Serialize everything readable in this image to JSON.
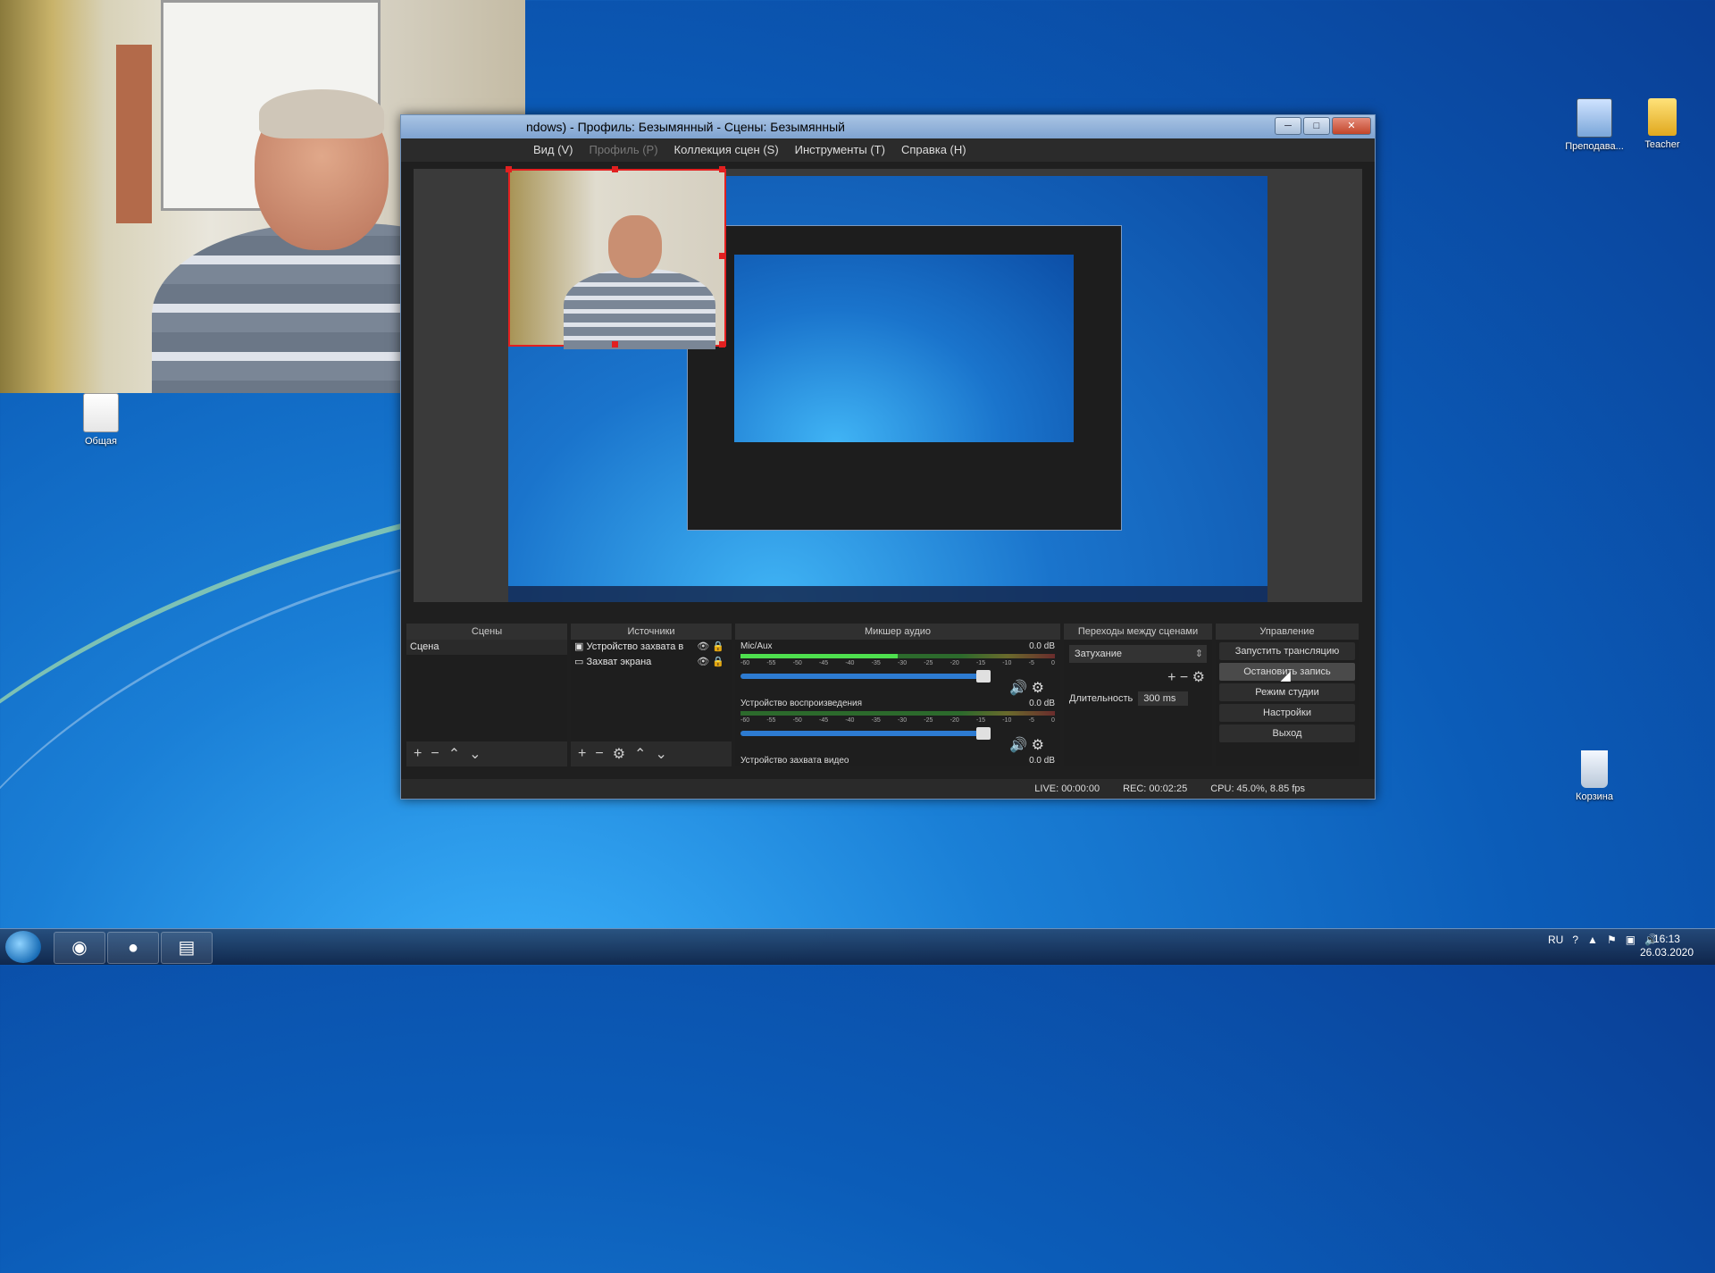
{
  "desktop": {
    "icons": [
      {
        "label": "Общая",
        "icon": "shared-folder-icon"
      },
      {
        "label": "Преподава...",
        "icon": "teacher-shortcut-icon"
      },
      {
        "label": "Teacher",
        "icon": "folder-icon"
      },
      {
        "label": "Корзина",
        "icon": "recycle-bin-icon"
      }
    ]
  },
  "obs": {
    "title": "ndows) - Профиль: Безымянный - Сцены: Безымянный",
    "menu": [
      "Вид (V)",
      "Профиль (P)",
      "Коллекция сцен (S)",
      "Инструменты (T)",
      "Справка (H)"
    ],
    "docks": {
      "scenes": {
        "title": "Сцены",
        "items": [
          "Сцена"
        ]
      },
      "sources": {
        "title": "Источники",
        "items": [
          "Устройство захвата в",
          "Захват экрана"
        ]
      },
      "mixer": {
        "title": "Микшер аудио",
        "tracks": [
          {
            "name": "Mic/Aux",
            "db": "0.0 dB"
          },
          {
            "name": "Устройство воспроизведения",
            "db": "0.0 dB"
          },
          {
            "name": "Устройство захвата видео",
            "db": "0.0 dB"
          }
        ],
        "ticks": [
          "-60",
          "-55",
          "-50",
          "-45",
          "-40",
          "-35",
          "-30",
          "-25",
          "-20",
          "-15",
          "-10",
          "-5",
          "0"
        ]
      },
      "transitions": {
        "title": "Переходы между сценами",
        "selected": "Затухание",
        "duration_label": "Длительность",
        "duration_value": "300 ms"
      },
      "controls": {
        "title": "Управление",
        "buttons": [
          "Запустить трансляцию",
          "Остановить запись",
          "Режим студии",
          "Настройки",
          "Выход"
        ]
      }
    },
    "status": {
      "live": "LIVE: 00:00:00",
      "rec": "REC: 00:02:25",
      "cpu": "CPU: 45.0%, 8.85 fps"
    }
  },
  "taskbar": {
    "lang": "RU",
    "time": "16:13",
    "date": "26.03.2020",
    "apps": [
      "start-orb-icon",
      "firefox-icon",
      "obs-icon",
      "explorer-icon"
    ]
  }
}
